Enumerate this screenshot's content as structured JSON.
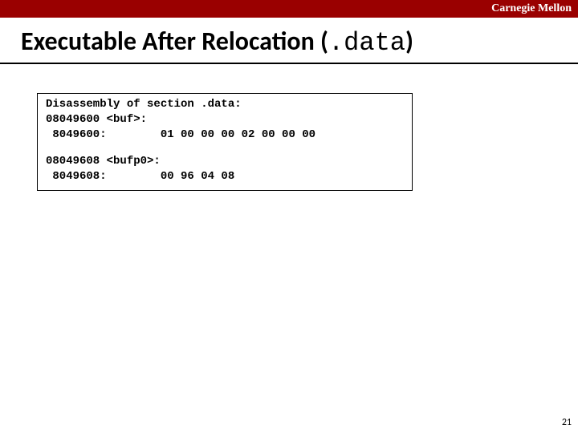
{
  "header": {
    "brand": "Carnegie Mellon"
  },
  "title": {
    "prefix": "Executable After Relocation (",
    "mono": ".data",
    "suffix": ")"
  },
  "code": {
    "l1": "Disassembly of section .data:",
    "l2": "08049600 <buf>:",
    "l3": " 8049600:        01 00 00 00 02 00 00 00",
    "l4": "08049608 <bufp0>:",
    "l5": " 8049608:        00 96 04 08"
  },
  "page": "21"
}
